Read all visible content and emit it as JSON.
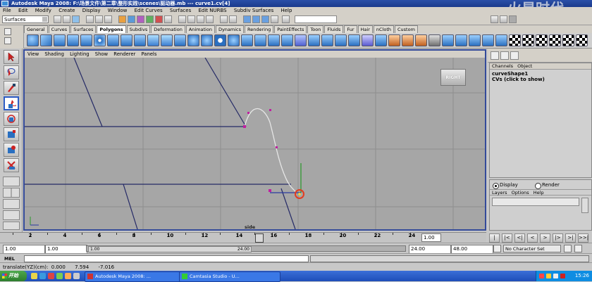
{
  "window": {
    "title": "Autodesk Maya 2008: F:\\场景文件\\第二章\\整形实践\\scenes\\驱动器.mb   ---   curve1.cv[4]",
    "watermark": "火星时代"
  },
  "menubar": {
    "items": [
      "File",
      "Edit",
      "Modify",
      "Create",
      "Display",
      "Window",
      "Edit Curves",
      "Surfaces",
      "Edit NURBS",
      "Subdiv Surfaces",
      "Help"
    ]
  },
  "status_line": {
    "menu_set": "Surfaces"
  },
  "shelf": {
    "tabs": [
      "General",
      "Curves",
      "Surfaces",
      "Polygons",
      "Subdivs",
      "Deformation",
      "Animation",
      "Dynamics",
      "Rendering",
      "PaintEffects",
      "Toon",
      "Fluids",
      "Fur",
      "Hair",
      "nCloth",
      "Custom"
    ],
    "active_tab": "Polygons"
  },
  "panel": {
    "menu": [
      "View",
      "Shading",
      "Lighting",
      "Show",
      "Renderer",
      "Panels"
    ],
    "view_cube_label": "RIGHT",
    "camera_label": "side"
  },
  "channel_box": {
    "menu": [
      "Channels",
      "Object"
    ],
    "node_name": "curveShape1",
    "cvs_label": "CVs (click to show)"
  },
  "layer_editor": {
    "display_label": "Display",
    "render_label": "Render",
    "menu": [
      "Layers",
      "Options",
      "Help"
    ]
  },
  "time_slider": {
    "ticks": [
      "2",
      "4",
      "6",
      "8",
      "10",
      "12",
      "14",
      "16",
      "18",
      "20",
      "22",
      "24"
    ],
    "current_frame": "1.00",
    "current_frame_index": 16
  },
  "playback": {
    "buttons": [
      "|<<",
      "|<",
      "<|",
      "<",
      ">",
      "|>",
      ">|",
      ">>|"
    ]
  },
  "range_slider": {
    "start_time": "1.00",
    "playback_start": "1.00",
    "thumb_start_label": "1.00",
    "thumb_end_label": "24.00",
    "playback_end": "24.00",
    "end_time": "48.00",
    "character_set": "No Character Set"
  },
  "command_line": {
    "label": "MEL",
    "input": "",
    "result": ""
  },
  "help_line": {
    "text": "translate(YZ)(cm):  0.000      7.594      -7.016"
  },
  "taskbar": {
    "start_label": "开始",
    "tasks": [
      {
        "label": "Autodesk Maya 2008: ..."
      },
      {
        "label": "Camtasia Studio - U..."
      }
    ],
    "clock": "15:26"
  },
  "colors": {
    "viewport_bg": "#a6a6a6",
    "grid_line": "#8e8e8e",
    "axis_line": "#252a66",
    "curve": "#e6e6e6",
    "cv_point": "#c020a0",
    "selection_handle": "#e33c20"
  }
}
